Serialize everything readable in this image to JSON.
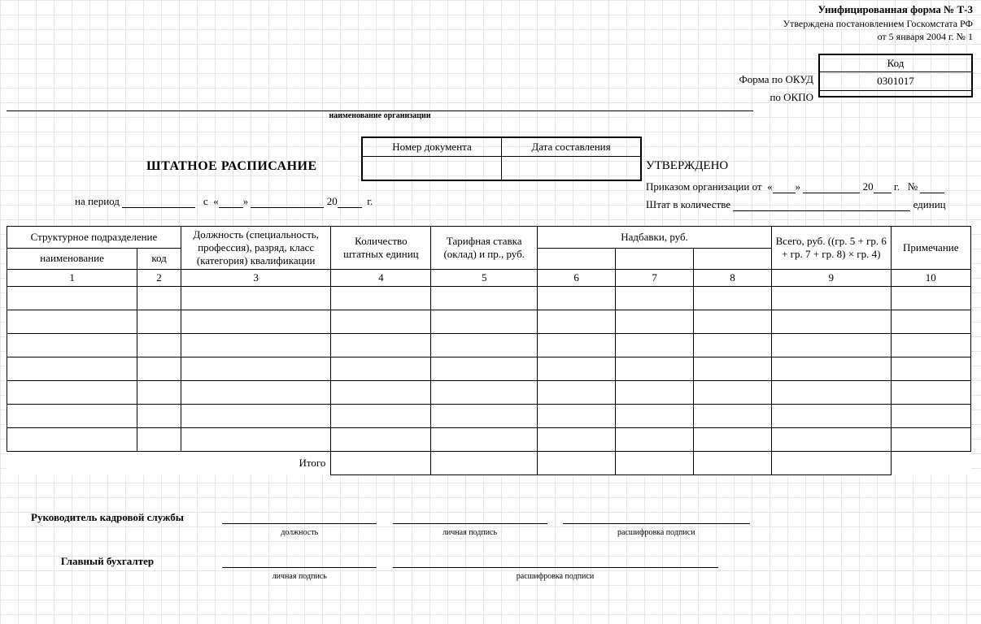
{
  "header": {
    "form_title": "Унифицированная форма № Т-3",
    "approved_by": "Утверждена постановлением Госкомстата РФ",
    "approved_date": "от 5 января 2004 г. № 1",
    "code_header": "Код",
    "okud_label": "Форма по ОКУД",
    "okud_value": "0301017",
    "okpo_label": "по ОКПО",
    "okpo_value": "",
    "org_caption": "наименование организации"
  },
  "docbox": {
    "num_label": "Номер документа",
    "date_label": "Дата составления",
    "num_value": "",
    "date_value": ""
  },
  "title": "ШТАТНОЕ РАСПИСАНИЕ",
  "period": {
    "prefix": "на период",
    "from": "с",
    "year_prefix": "20",
    "year_suffix": "г.",
    "quote_open": "«",
    "quote_close": "»"
  },
  "approval": {
    "title": "УТВЕРЖДЕНО",
    "order_prefix": "Приказом организации от",
    "year_prefix": "20",
    "year_suffix": "г.",
    "num_sign": "№",
    "staff_prefix": "Штат в количестве",
    "staff_suffix": "единиц",
    "quote_open": "«",
    "quote_close": "»"
  },
  "table": {
    "headers": {
      "struct": "Структурное подразделение",
      "struct_name": "наименование",
      "struct_code": "код",
      "position": "Должность (специальность, профессия), разряд, класс (категория) квалификации",
      "count": "Количество штатных единиц",
      "rate": "Тарифная ставка (оклад) и пр., руб.",
      "addons": "Надбавки, руб.",
      "total": "Всего, руб. ((гр. 5 + гр. 6 + гр. 7 + гр. 8) × гр. 4)",
      "note": "Примечание"
    },
    "col_numbers": [
      "1",
      "2",
      "3",
      "4",
      "5",
      "6",
      "7",
      "8",
      "9",
      "10"
    ],
    "total_label": "Итого",
    "data_rows": 7
  },
  "signatures": {
    "hr_head": "Руководитель кадровой службы",
    "chief_acc": "Главный бухгалтер",
    "caption_position": "должность",
    "caption_signature": "личная подпись",
    "caption_decipher": "расшифровка подписи"
  }
}
